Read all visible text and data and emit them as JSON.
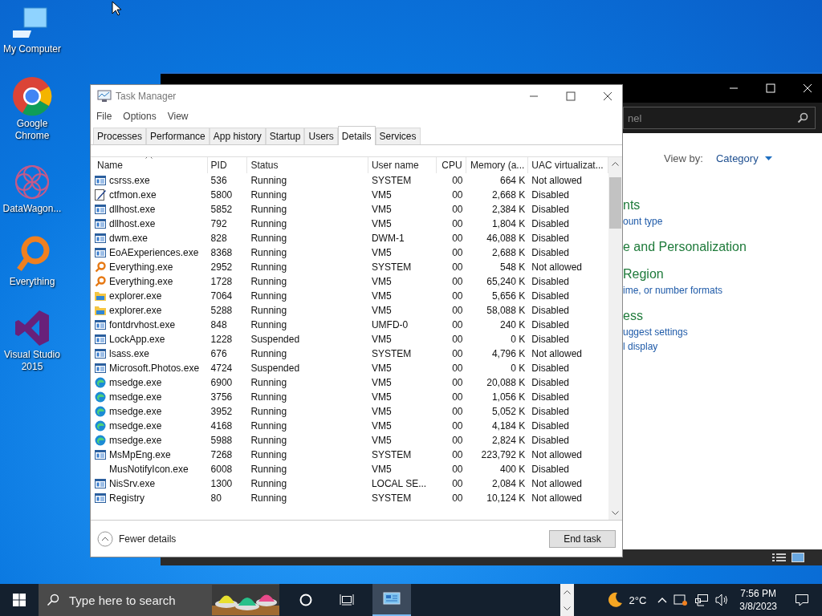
{
  "desktop_icons": [
    {
      "label": "My Computer",
      "kind": "computer"
    },
    {
      "label": "Google\nChrome",
      "kind": "chrome"
    },
    {
      "label": "DataWagon...",
      "kind": "datawagon"
    },
    {
      "label": "Everything",
      "kind": "everything"
    },
    {
      "label": "Visual Studio\n2015",
      "kind": "vs"
    }
  ],
  "background_window": {
    "search": {
      "placeholder": "nel"
    },
    "view_by": "View by:",
    "view_by_value": "Category",
    "lines": [
      {
        "text": "nts",
        "kind": "heading"
      },
      {
        "text": "ount type",
        "kind": "link"
      },
      {
        "text": "e and Personalization",
        "kind": "heading"
      },
      {
        "text": "Region",
        "kind": "heading"
      },
      {
        "text": "ime, or number formats",
        "kind": "link"
      },
      {
        "text": "ess",
        "kind": "heading"
      },
      {
        "text": "uggest settings",
        "kind": "link"
      },
      {
        "text": "l display",
        "kind": "link"
      }
    ]
  },
  "window": {
    "title": "Task Manager"
  },
  "menu": [
    "File",
    "Options",
    "View"
  ],
  "tabs": [
    {
      "label": "Processes",
      "selected": false
    },
    {
      "label": "Performance",
      "selected": false
    },
    {
      "label": "App history",
      "selected": false
    },
    {
      "label": "Startup",
      "selected": false
    },
    {
      "label": "Users",
      "selected": false
    },
    {
      "label": "Details",
      "selected": true
    },
    {
      "label": "Services",
      "selected": false
    }
  ],
  "table": {
    "columns": [
      "Name",
      "PID",
      "Status",
      "User name",
      "CPU",
      "Memory (a...",
      "UAC virtualizat..."
    ],
    "rows": [
      {
        "kind": "app",
        "cells": [
          "csrss.exe",
          "536",
          "Running",
          "SYSTEM",
          "00",
          "664 K",
          "Not allowed"
        ]
      },
      {
        "kind": "pen",
        "cells": [
          "ctfmon.exe",
          "5800",
          "Running",
          "VM5",
          "00",
          "2,668 K",
          "Disabled"
        ]
      },
      {
        "kind": "app",
        "cells": [
          "dllhost.exe",
          "5852",
          "Running",
          "VM5",
          "00",
          "2,384 K",
          "Disabled"
        ]
      },
      {
        "kind": "app",
        "cells": [
          "dllhost.exe",
          "792",
          "Running",
          "VM5",
          "00",
          "1,804 K",
          "Disabled"
        ]
      },
      {
        "kind": "app",
        "cells": [
          "dwm.exe",
          "828",
          "Running",
          "DWM-1",
          "00",
          "46,088 K",
          "Disabled"
        ]
      },
      {
        "kind": "app",
        "cells": [
          "EoAExperiences.exe",
          "8368",
          "Running",
          "VM5",
          "00",
          "2,688 K",
          "Disabled"
        ]
      },
      {
        "kind": "magnifier",
        "cells": [
          "Everything.exe",
          "2952",
          "Running",
          "SYSTEM",
          "00",
          "548 K",
          "Not allowed"
        ]
      },
      {
        "kind": "magnifier",
        "cells": [
          "Everything.exe",
          "1728",
          "Running",
          "VM5",
          "00",
          "65,240 K",
          "Disabled"
        ]
      },
      {
        "kind": "folder",
        "cells": [
          "explorer.exe",
          "7064",
          "Running",
          "VM5",
          "00",
          "5,656 K",
          "Disabled"
        ]
      },
      {
        "kind": "folder",
        "cells": [
          "explorer.exe",
          "5288",
          "Running",
          "VM5",
          "00",
          "58,088 K",
          "Disabled"
        ]
      },
      {
        "kind": "app",
        "cells": [
          "fontdrvhost.exe",
          "848",
          "Running",
          "UMFD-0",
          "00",
          "240 K",
          "Disabled"
        ]
      },
      {
        "kind": "app",
        "cells": [
          "LockApp.exe",
          "1228",
          "Suspended",
          "VM5",
          "00",
          "0 K",
          "Disabled"
        ]
      },
      {
        "kind": "app",
        "cells": [
          "lsass.exe",
          "676",
          "Running",
          "SYSTEM",
          "00",
          "4,796 K",
          "Not allowed"
        ]
      },
      {
        "kind": "app",
        "cells": [
          "Microsoft.Photos.exe",
          "4724",
          "Suspended",
          "VM5",
          "00",
          "0 K",
          "Disabled"
        ]
      },
      {
        "kind": "edge",
        "cells": [
          "msedge.exe",
          "6900",
          "Running",
          "VM5",
          "00",
          "20,088 K",
          "Disabled"
        ]
      },
      {
        "kind": "edge",
        "cells": [
          "msedge.exe",
          "3756",
          "Running",
          "VM5",
          "00",
          "1,056 K",
          "Disabled"
        ]
      },
      {
        "kind": "edge",
        "cells": [
          "msedge.exe",
          "3952",
          "Running",
          "VM5",
          "00",
          "5,052 K",
          "Disabled"
        ]
      },
      {
        "kind": "edge",
        "cells": [
          "msedge.exe",
          "4168",
          "Running",
          "VM5",
          "00",
          "4,184 K",
          "Disabled"
        ]
      },
      {
        "kind": "edge",
        "cells": [
          "msedge.exe",
          "5988",
          "Running",
          "VM5",
          "00",
          "2,824 K",
          "Disabled"
        ]
      },
      {
        "kind": "app",
        "cells": [
          "MsMpEng.exe",
          "7268",
          "Running",
          "SYSTEM",
          "00",
          "223,792 K",
          "Not allowed"
        ]
      },
      {
        "kind": "none",
        "cells": [
          "MusNotifyIcon.exe",
          "6008",
          "Running",
          "VM5",
          "00",
          "400 K",
          "Disabled"
        ]
      },
      {
        "kind": "app",
        "cells": [
          "NisSrv.exe",
          "1300",
          "Running",
          "LOCAL SE...",
          "00",
          "2,084 K",
          "Not allowed"
        ]
      },
      {
        "kind": "app",
        "cells": [
          "Registry",
          "80",
          "Running",
          "SYSTEM",
          "00",
          "10,124 K",
          "Not allowed"
        ]
      }
    ]
  },
  "footer": {
    "toggle": "Fewer details",
    "button": "End task"
  },
  "taskbar": {
    "search": {
      "placeholder": "Type here to search"
    },
    "weather": "2°C",
    "time": "7:56 PM",
    "date": "3/8/2023"
  }
}
